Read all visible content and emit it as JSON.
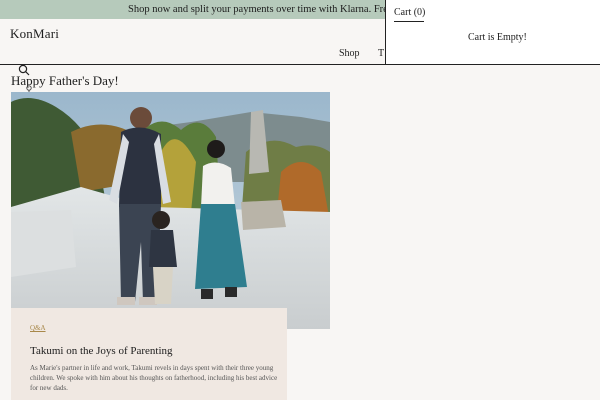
{
  "promo": {
    "text": "Shop now and split your payments over time with Klarna. Free Shipping ov"
  },
  "header": {
    "logo": "KonMari",
    "nav": [
      {
        "label": "Shop"
      },
      {
        "label": "T"
      }
    ]
  },
  "cart": {
    "tab_label": "Cart (0)",
    "empty_message": "Cart is Empty!"
  },
  "page": {
    "title": "Happy Father's Day!"
  },
  "article": {
    "hero_image": "family-walking-photo",
    "tag": "Q&A",
    "title": "Takumi on the Joys of Parenting",
    "description": "As Marie's partner in life and work, Takumi revels in days spent with their three young children. We spoke with him about his thoughts on fatherhood, including his best advice for new dads."
  },
  "colors": {
    "promo_bg": "#b6cabb",
    "page_bg": "#f8f6f4",
    "card_bg": "#f0e8e2",
    "tag": "#a8884a"
  },
  "icons": [
    "search-icon",
    "location-pin-icon"
  ]
}
